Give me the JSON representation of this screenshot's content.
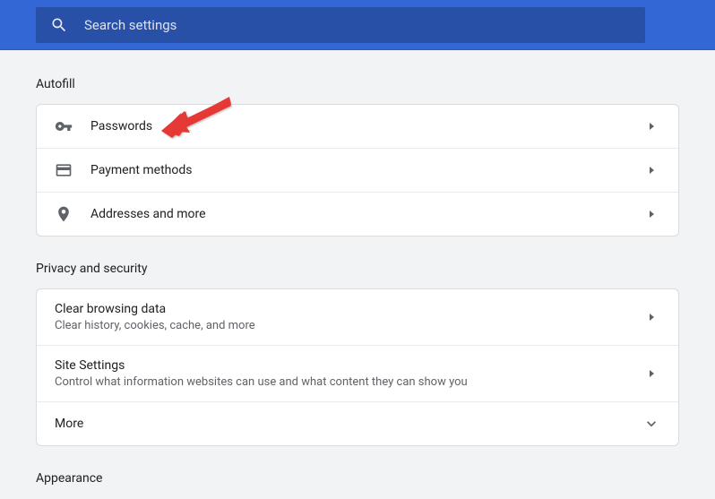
{
  "header": {
    "search_placeholder": "Search settings"
  },
  "sections": {
    "autofill": {
      "title": "Autofill",
      "passwords": "Passwords",
      "payment": "Payment methods",
      "addresses": "Addresses and more"
    },
    "privacy": {
      "title": "Privacy and security",
      "clear_title": "Clear browsing data",
      "clear_sub": "Clear history, cookies, cache, and more",
      "site_title": "Site Settings",
      "site_sub": "Control what information websites can use and what content they can show you",
      "more": "More"
    },
    "appearance": {
      "title": "Appearance"
    }
  }
}
